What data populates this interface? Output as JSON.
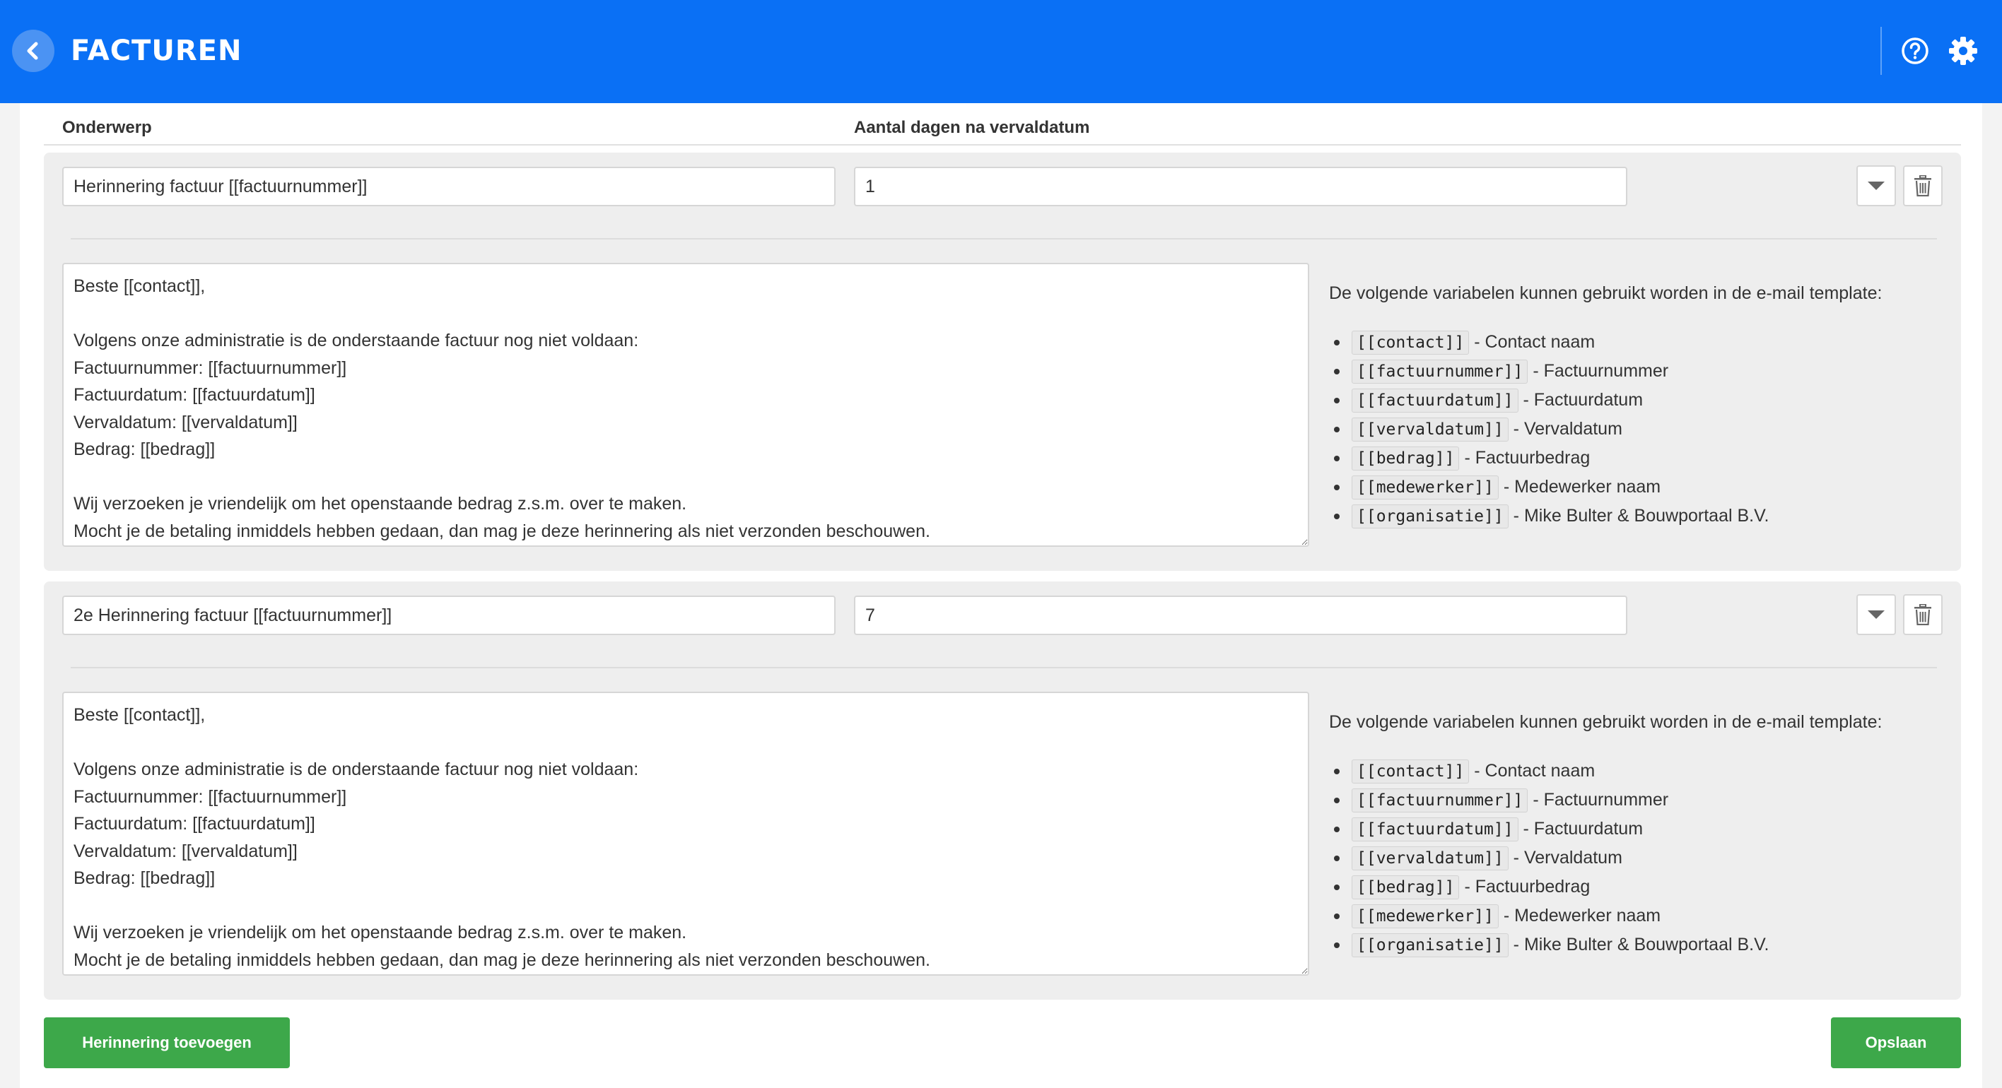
{
  "header": {
    "title": "FACTUREN",
    "brand_color": "#0a70f5",
    "icons": [
      "chevron-left-icon",
      "help-icon",
      "gear-icon"
    ]
  },
  "columns": {
    "subject": "Onderwerp",
    "days": "Aantal dagen na vervaldatum"
  },
  "vars_intro": "De volgende variabelen kunnen gebruikt worden in de e-mail template:",
  "reminders": [
    {
      "subject": "Herinnering factuur [[factuurnummer]]",
      "days": "1",
      "body": "Beste [[contact]],\n\nVolgens onze administratie is de onderstaande factuur nog niet voldaan:\nFactuurnummer: [[factuurnummer]]\nFactuurdatum: [[factuurdatum]]\nVervaldatum: [[vervaldatum]]\nBedrag: [[bedrag]]\n\nWij verzoeken je vriendelijk om het openstaande bedrag z.s.m. over te maken.\nMocht je de betaling inmiddels hebben gedaan, dan mag je deze herinnering als niet verzonden beschouwen."
    },
    {
      "subject": "2e Herinnering factuur [[factuurnummer]]",
      "days": "7",
      "body": "Beste [[contact]],\n\nVolgens onze administratie is de onderstaande factuur nog niet voldaan:\nFactuurnummer: [[factuurnummer]]\nFactuurdatum: [[factuurdatum]]\nVervaldatum: [[vervaldatum]]\nBedrag: [[bedrag]]\n\nWij verzoeken je vriendelijk om het openstaande bedrag z.s.m. over te maken.\nMocht je de betaling inmiddels hebben gedaan, dan mag je deze herinnering als niet verzonden beschouwen."
    }
  ],
  "variables": [
    {
      "code": "[[contact]]",
      "desc": "- Contact naam"
    },
    {
      "code": "[[factuurnummer]]",
      "desc": "- Factuurnummer"
    },
    {
      "code": "[[factuurdatum]]",
      "desc": "- Factuurdatum"
    },
    {
      "code": "[[vervaldatum]]",
      "desc": "- Vervaldatum"
    },
    {
      "code": "[[bedrag]]",
      "desc": "- Factuurbedrag"
    },
    {
      "code": "[[medewerker]]",
      "desc": "- Medewerker naam"
    },
    {
      "code": "[[organisatie]]",
      "desc": "- Mike Bulter & Bouwportaal B.V."
    }
  ],
  "buttons": {
    "add": "Herinnering toevoegen",
    "save": "Opslaan",
    "color": "#3da84a"
  }
}
